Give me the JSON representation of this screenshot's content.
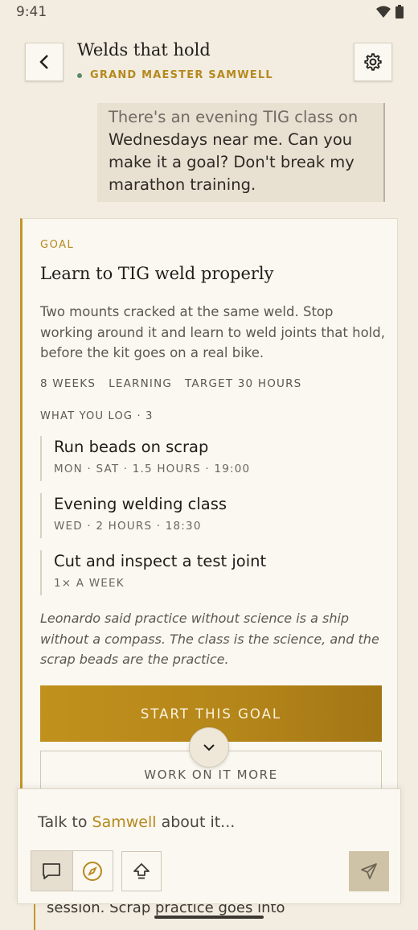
{
  "status": {
    "time": "9:41"
  },
  "header": {
    "title": "Welds that hold",
    "subtitle": "GRAND MAESTER SAMWELL"
  },
  "message": {
    "faded_line": "There's an evening TIG class on",
    "lines": [
      "Wednesdays near me. Can you",
      "make it a goal? Don't break my",
      "marathon training."
    ]
  },
  "goal": {
    "label": "GOAL",
    "title": "Learn to TIG weld properly",
    "description": "Two mounts cracked at the same weld. Stop working around it and learn to weld joints that hold, before the kit goes on a real bike.",
    "meta": [
      "8 WEEKS",
      "LEARNING",
      "TARGET 30 HOURS"
    ],
    "log_label": "WHAT YOU LOG · 3",
    "logs": [
      {
        "name": "Run beads on scrap",
        "detail": "MON · SAT · 1.5 HOURS · 19:00"
      },
      {
        "name": "Evening welding class",
        "detail": "WED · 2 HOURS · 18:30"
      },
      {
        "name": "Cut and inspect a test joint",
        "detail": "1× A WEEK"
      }
    ],
    "quote": "Leonardo said practice without science is a ship without a compass. The class is the science, and the scrap beads are the practice.",
    "start_label": "START THIS GOAL",
    "more_label": "WORK ON IT MORE"
  },
  "behind_text": "session. Scrap practice goes into",
  "composer": {
    "prefix": "Talk to ",
    "name": "Samwell",
    "suffix": " about it..."
  },
  "colors": {
    "accent": "#b5891e",
    "background": "#f3ede1",
    "card": "#fbf8f1"
  }
}
